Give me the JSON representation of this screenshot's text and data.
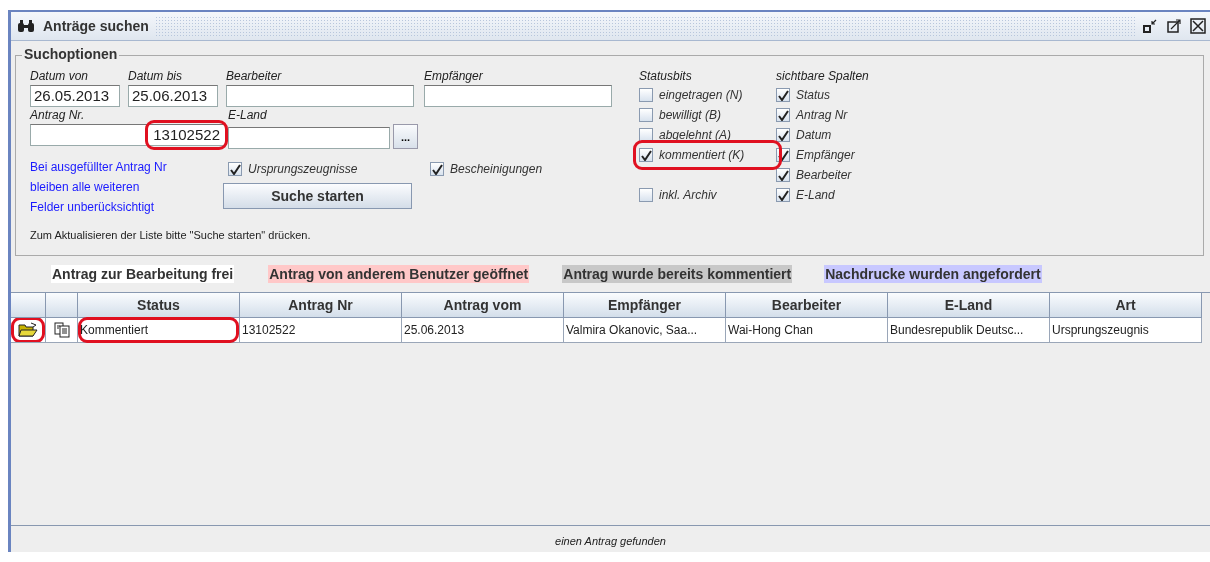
{
  "window": {
    "title": "Anträge suchen"
  },
  "search_options": {
    "title": "Suchoptionen",
    "fields_row1": [
      {
        "label": "Datum von",
        "value": "26.05.2013"
      },
      {
        "label": "Datum bis",
        "value": "25.06.2013"
      },
      {
        "label": "Bearbeiter"
      },
      {
        "label": "Empfänger"
      }
    ],
    "antrag_nr": {
      "label": "Antrag Nr.",
      "value": "13102522",
      "highlighted": true
    },
    "e_land": {
      "label": "E-Land",
      "button": "..."
    },
    "note": "Bei ausgefüllter Antrag Nr bleiben alle weiteren Felder unberücksichtigt",
    "type_checkboxes": [
      {
        "label": "Ursprungszeugnisse",
        "checked": true
      },
      {
        "label": "Bescheinigungen",
        "checked": true
      }
    ],
    "search_button": "Suche starten",
    "hint": "Zum Aktualisieren der Liste bitte \"Suche starten\" drücken.",
    "statusbits": {
      "title": "Statusbits",
      "items": [
        {
          "label": "eingetragen (N)",
          "checked": false,
          "highlighted": false
        },
        {
          "label": "bewilligt (B)",
          "checked": false,
          "highlighted": false
        },
        {
          "label": "abgelehnt (A)",
          "checked": false,
          "highlighted": false
        },
        {
          "label": "kommentiert (K)",
          "checked": true,
          "highlighted": true
        }
      ],
      "archive": {
        "label": "inkl. Archiv",
        "checked": false
      }
    },
    "visible_columns": {
      "title": "sichtbare Spalten",
      "items": [
        {
          "label": "Status",
          "checked": true
        },
        {
          "label": "Antrag Nr",
          "checked": true
        },
        {
          "label": "Datum",
          "checked": true
        },
        {
          "label": "Empfänger",
          "checked": true
        },
        {
          "label": "Bearbeiter",
          "checked": true
        },
        {
          "label": "E-Land",
          "checked": true
        }
      ]
    }
  },
  "legend": [
    {
      "label": "Antrag zur Bearbeitung frei",
      "color": "#ffffff"
    },
    {
      "label": "Antrag von anderem Benutzer geöffnet",
      "color": "#ffc8c8"
    },
    {
      "label": "Antrag wurde bereits kommentiert",
      "color": "#c8c8c8"
    },
    {
      "label": "Nachdrucke wurden angefordert",
      "color": "#c8c8ff"
    }
  ],
  "table": {
    "columns": [
      "Status",
      "Antrag Nr",
      "Antrag vom",
      "Empfänger",
      "Bearbeiter",
      "E-Land",
      "Art"
    ],
    "rows": [
      {
        "cells": [
          "Kommentiert",
          "13102522",
          "25.06.2013",
          "Valmira Okanovic, Saa...",
          "Wai-Hong Chan",
          "Bundesrepublik Deutsc...",
          "Ursprungszeugnis"
        ],
        "open_highlighted": true,
        "status_highlighted": true
      }
    ]
  },
  "status_bar": "einen Antrag gefunden"
}
